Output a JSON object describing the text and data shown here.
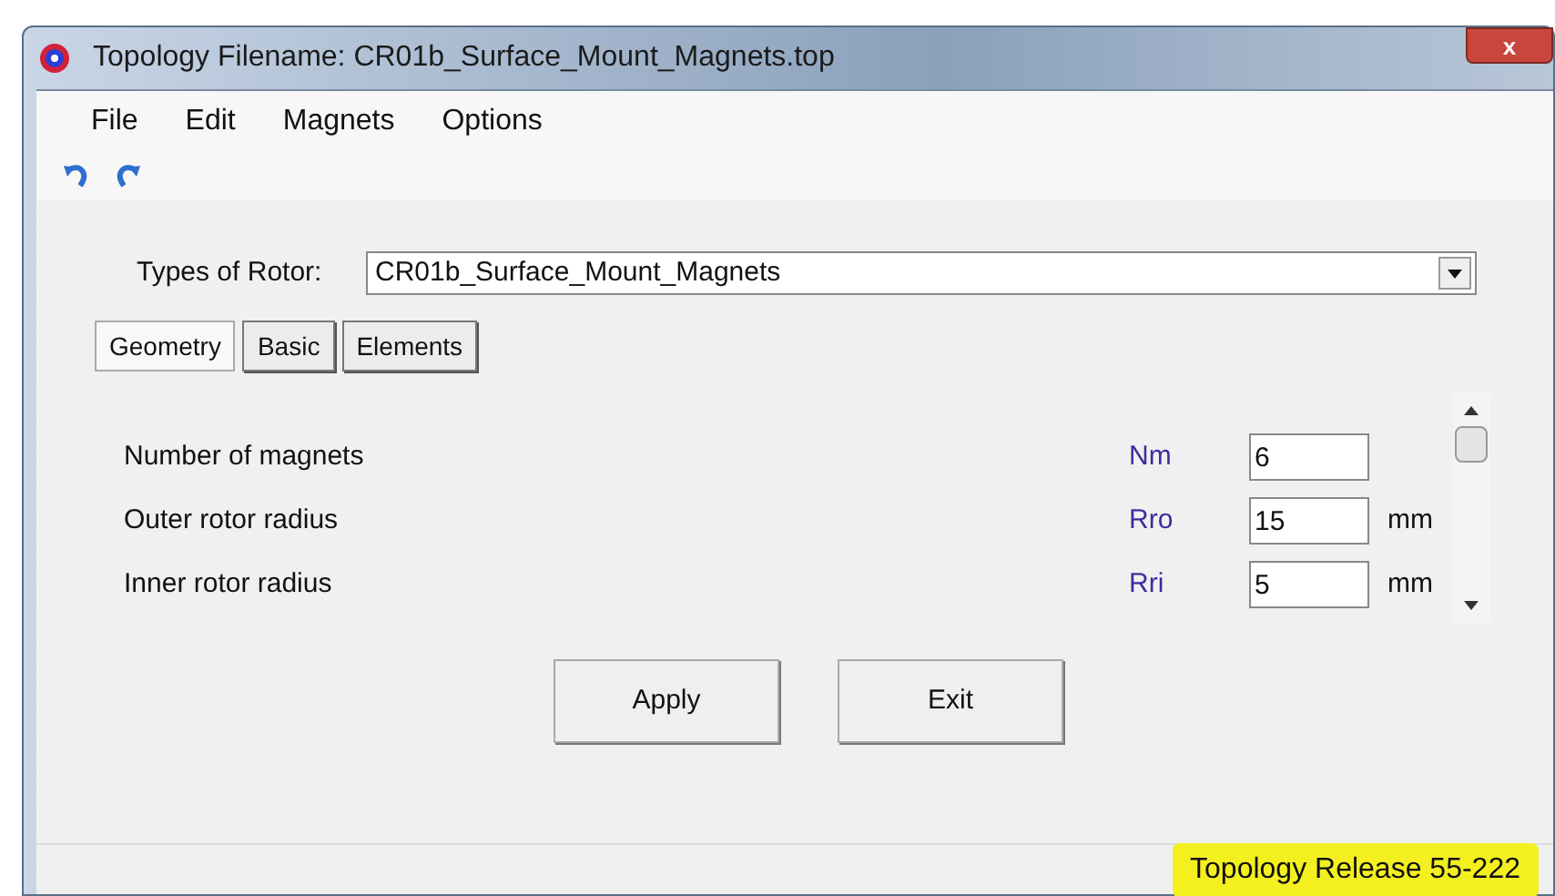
{
  "window": {
    "title": "Topology Filename: CR01b_Surface_Mount_Magnets.top",
    "close": "x"
  },
  "menu": [
    "File",
    "Edit",
    "Magnets",
    "Options"
  ],
  "rotor_type": {
    "label": "Types of Rotor:",
    "value": "CR01b_Surface_Mount_Magnets"
  },
  "tabs": [
    {
      "label": "Geometry",
      "selected": true
    },
    {
      "label": "Basic",
      "selected": false
    },
    {
      "label": "Elements",
      "selected": false
    }
  ],
  "params": [
    {
      "label": "Number of magnets",
      "symbol": "Nm",
      "value": "6"
    },
    {
      "label": "Outer rotor radius",
      "symbol": "Rro",
      "value": "15",
      "unit": "mm"
    },
    {
      "label": "Inner rotor radius",
      "symbol": "Rri",
      "value": "5",
      "unit": "mm"
    }
  ],
  "buttons": [
    "Apply",
    "Exit"
  ],
  "status_bar": "Topology Release 55-222"
}
